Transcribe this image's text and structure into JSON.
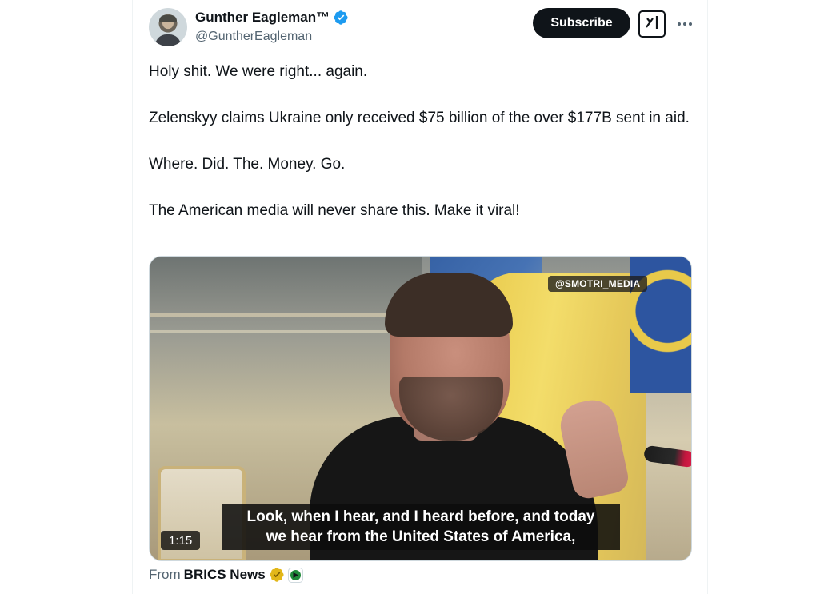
{
  "author": {
    "display_name": "Gunther Eagleman™",
    "handle": "@GuntherEagleman",
    "verified": true,
    "avatar_icon": "avatar"
  },
  "header": {
    "subscribe_label": "Subscribe",
    "grok_icon": "grok-icon",
    "more_icon": "more-icon"
  },
  "tweet": {
    "paragraphs": [
      "Holy shit. We were right... again.",
      "Zelenskyy claims Ukraine only received $75 billion of the over $177B sent in aid.",
      "Where. Did. The. Money. Go.",
      "The American media will never share this. Make it viral!"
    ]
  },
  "media": {
    "watermark": "@SMOTRI_MEDIA",
    "subtitle_line1": "Look, when I hear, and I heard before, and today",
    "subtitle_line2": "we hear from the United States of America,",
    "duration": "1:15"
  },
  "attribution": {
    "from_label": "From",
    "source_name": "BRICS News",
    "badges": [
      "gold-verified-icon",
      "affiliate-icon"
    ]
  },
  "colors": {
    "text": "#0f1419",
    "secondary": "#536471",
    "verified_blue": "#1d9bf0",
    "gold_badge": "#e2b719"
  }
}
